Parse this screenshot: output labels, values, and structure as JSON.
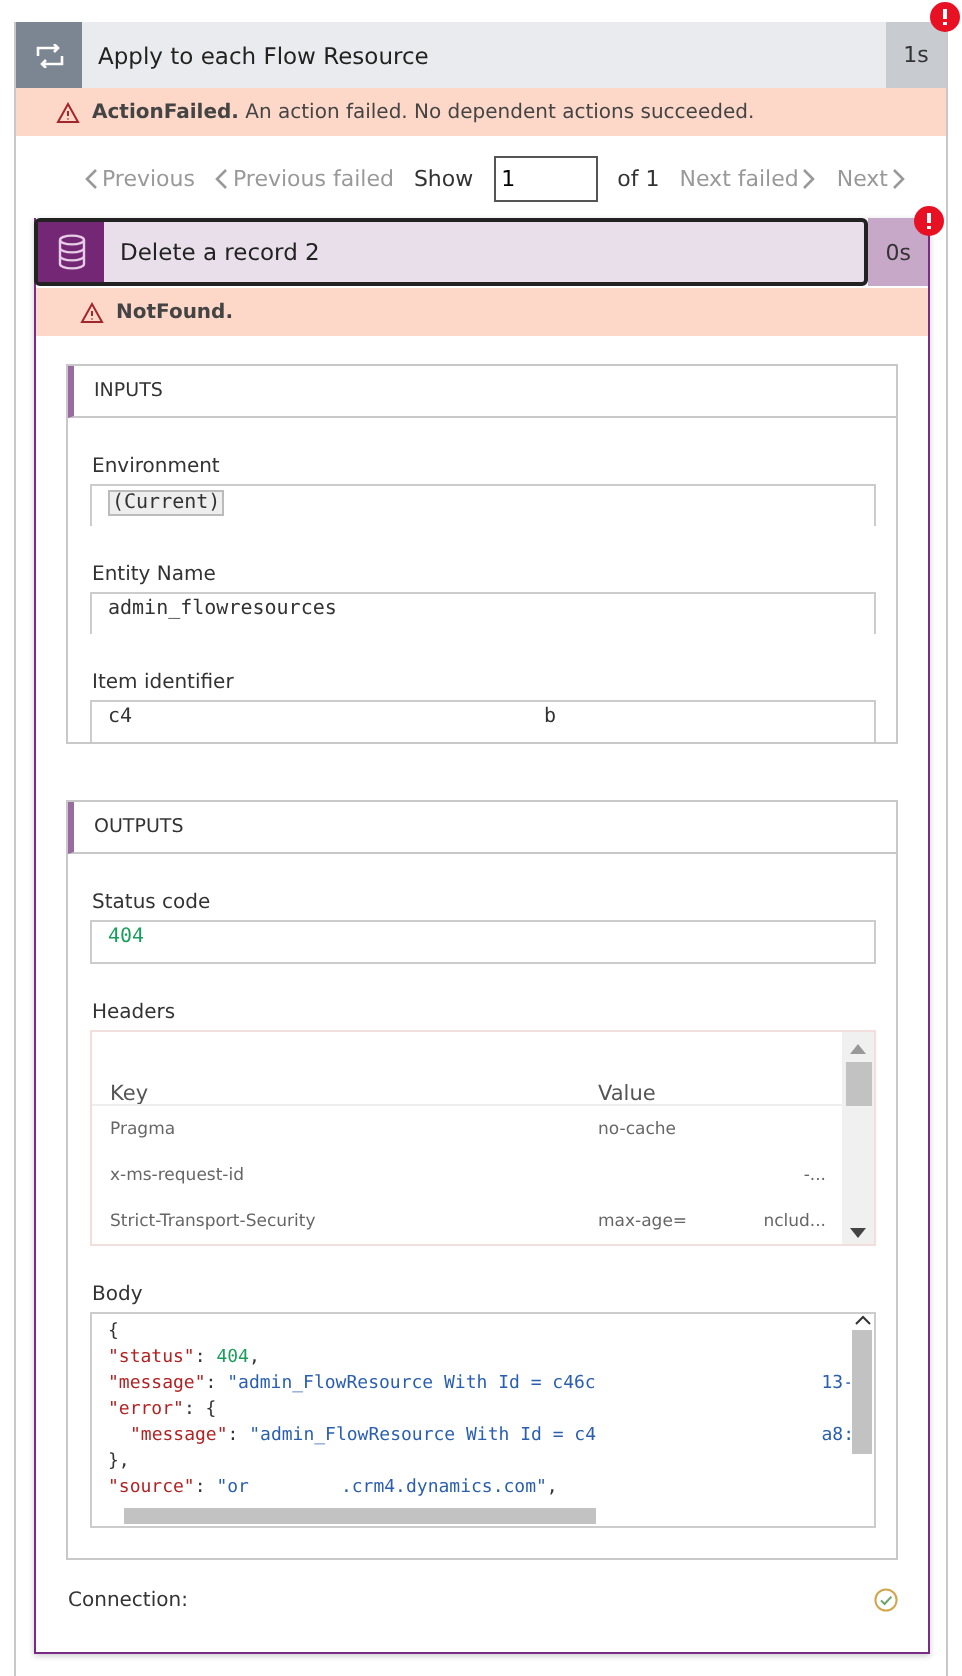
{
  "outer": {
    "title": "Apply to each Flow Resource",
    "duration": "1s",
    "error_code": "ActionFailed.",
    "error_text": "An action failed. No dependent actions succeeded."
  },
  "pager": {
    "previous": "Previous",
    "previous_failed": "Previous failed",
    "show": "Show",
    "value": "1",
    "of": "of 1",
    "next_failed": "Next failed",
    "next": "Next"
  },
  "action": {
    "title": "Delete a record 2",
    "duration": "0s",
    "error_code": "NotFound."
  },
  "inputs": {
    "heading": "INPUTS",
    "fields": [
      {
        "label": "Environment",
        "parts": [
          "(Current)"
        ],
        "kind": "token"
      },
      {
        "label": "Entity Name",
        "parts": [
          "admin_flowresources"
        ],
        "kind": "plain"
      },
      {
        "label": "Item identifier",
        "parts": [
          "c4",
          "b"
        ],
        "kind": "plain"
      }
    ]
  },
  "outputs": {
    "heading": "OUTPUTS",
    "status_label": "Status code",
    "status_value": "404",
    "headers_label": "Headers",
    "columns": [
      "Key",
      "Value"
    ],
    "rows": [
      {
        "key": "Pragma",
        "parts": [
          "no-cache"
        ]
      },
      {
        "key": "x-ms-request-id",
        "parts": [
          "-..."
        ]
      },
      {
        "key": "Strict-Transport-Security",
        "parts": [
          "max-age=",
          "nclud..."
        ]
      }
    ],
    "body_label": "Body",
    "body_lines": [
      {
        "tokens": [
          {
            "kind": "punct",
            "text": "{"
          }
        ]
      },
      {
        "tokens": [
          {
            "kind": "key",
            "text": "\"status\""
          },
          {
            "kind": "punct",
            "text": ": "
          },
          {
            "kind": "number",
            "text": "404"
          },
          {
            "kind": "punct",
            "text": ","
          }
        ]
      },
      {
        "tokens": [
          {
            "kind": "key",
            "text": "\"message\""
          },
          {
            "kind": "punct",
            "text": ": "
          },
          {
            "kind": "string",
            "text": "\"admin_FlowResource With Id = c46c"
          }
        ],
        "tail": "13-"
      },
      {
        "tokens": [
          {
            "kind": "key",
            "text": "\"error\""
          },
          {
            "kind": "punct",
            "text": ": {"
          }
        ]
      },
      {
        "indent": true,
        "tokens": [
          {
            "kind": "key",
            "text": "\"message\""
          },
          {
            "kind": "punct",
            "text": ": "
          },
          {
            "kind": "string",
            "text": "\"admin_FlowResource With Id = c4"
          }
        ],
        "tail": "a8:"
      },
      {
        "tokens": [
          {
            "kind": "punct",
            "text": "},"
          }
        ]
      },
      {
        "tokens": [
          {
            "kind": "key",
            "text": "\"source\""
          },
          {
            "kind": "punct",
            "text": ": "
          },
          {
            "kind": "string",
            "text": "\"or"
          },
          {
            "kind": "string",
            "text": ".crm4.dynamics.com\"",
            "gap": true
          },
          {
            "kind": "punct",
            "text": ","
          }
        ]
      }
    ]
  },
  "connection": {
    "label": "Connection:",
    "ok": true
  }
}
